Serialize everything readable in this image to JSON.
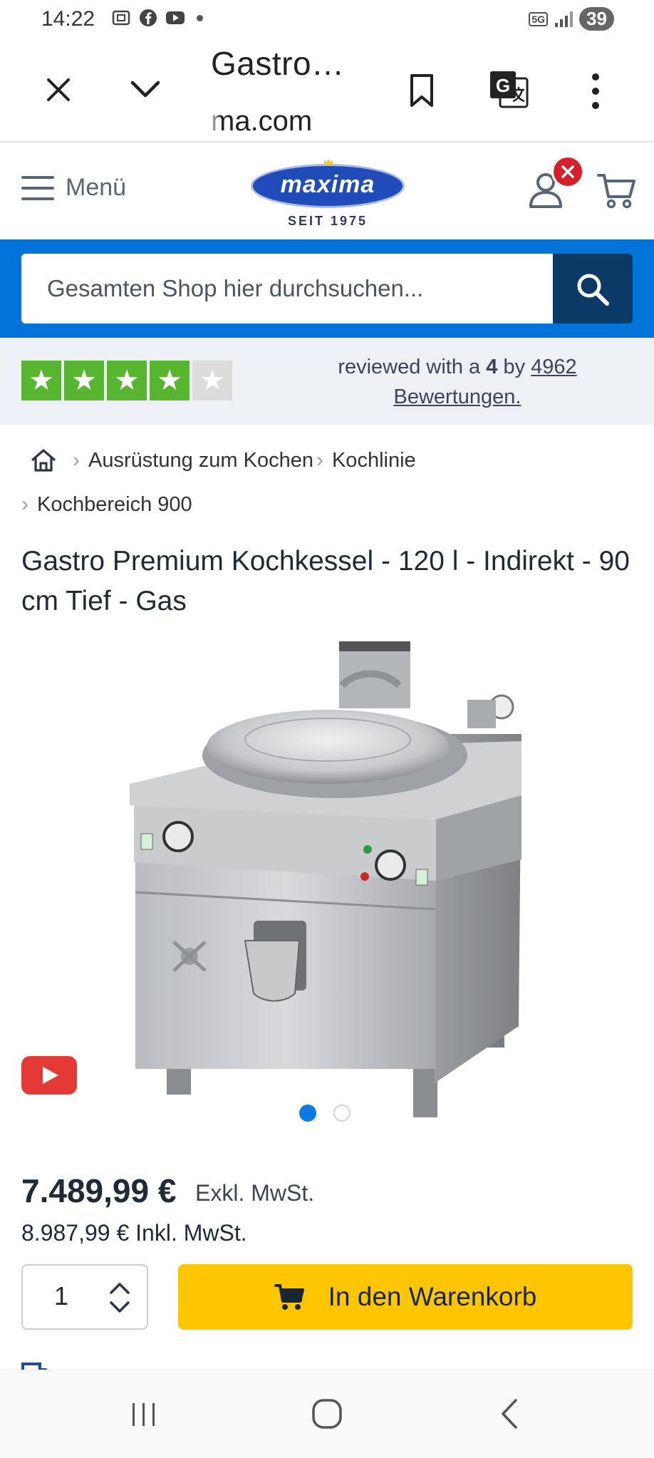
{
  "status_bar": {
    "time": "14:22",
    "network": "5G",
    "battery": "39"
  },
  "browser": {
    "title": "Gastro…",
    "url": "ma.com"
  },
  "header": {
    "menu_label": "Menü",
    "logo_text": "maxima",
    "logo_subtitle": "SEIT 1975"
  },
  "search": {
    "placeholder": "Gesamten Shop hier durchsuchen..."
  },
  "reviews": {
    "prefix": "reviewed with a",
    "rating": "4",
    "by": "by",
    "count": "4962",
    "count_label": "Bewertungen.",
    "stars_filled": 4,
    "stars_total": 5
  },
  "breadcrumb": {
    "items": [
      "Ausrüstung zum Kochen",
      "Kochlinie",
      "Kochbereich 900"
    ]
  },
  "product": {
    "title": "Gastro Premium Kochkessel - 120 l - Indirekt - 90 cm Tief - Gas",
    "price_net": "7.489,99 €",
    "price_net_label": "Exkl. MwSt.",
    "price_gross": "8.987,99 €",
    "price_gross_label": "Inkl. MwSt.",
    "quantity": "1",
    "add_to_cart_label": "In den Warenkorb",
    "gallery_dots": 2,
    "gallery_active": 1
  },
  "colors": {
    "brand_blue": "#0074d9",
    "search_button": "#0b3a66",
    "cart_button": "#fec600",
    "star_green": "#57b530",
    "badge_red": "#d61f2c",
    "video_red": "#e53935"
  },
  "icons": [
    "close-icon",
    "chevron-down-icon",
    "bookmark-icon",
    "translate-icon",
    "more-vert-icon",
    "hamburger-icon",
    "user-icon",
    "cart-icon",
    "search-icon",
    "home-icon",
    "youtube-icon",
    "cart-add-icon",
    "stepper-icon",
    "nav-recents-icon",
    "nav-home-icon",
    "nav-back-icon"
  ]
}
